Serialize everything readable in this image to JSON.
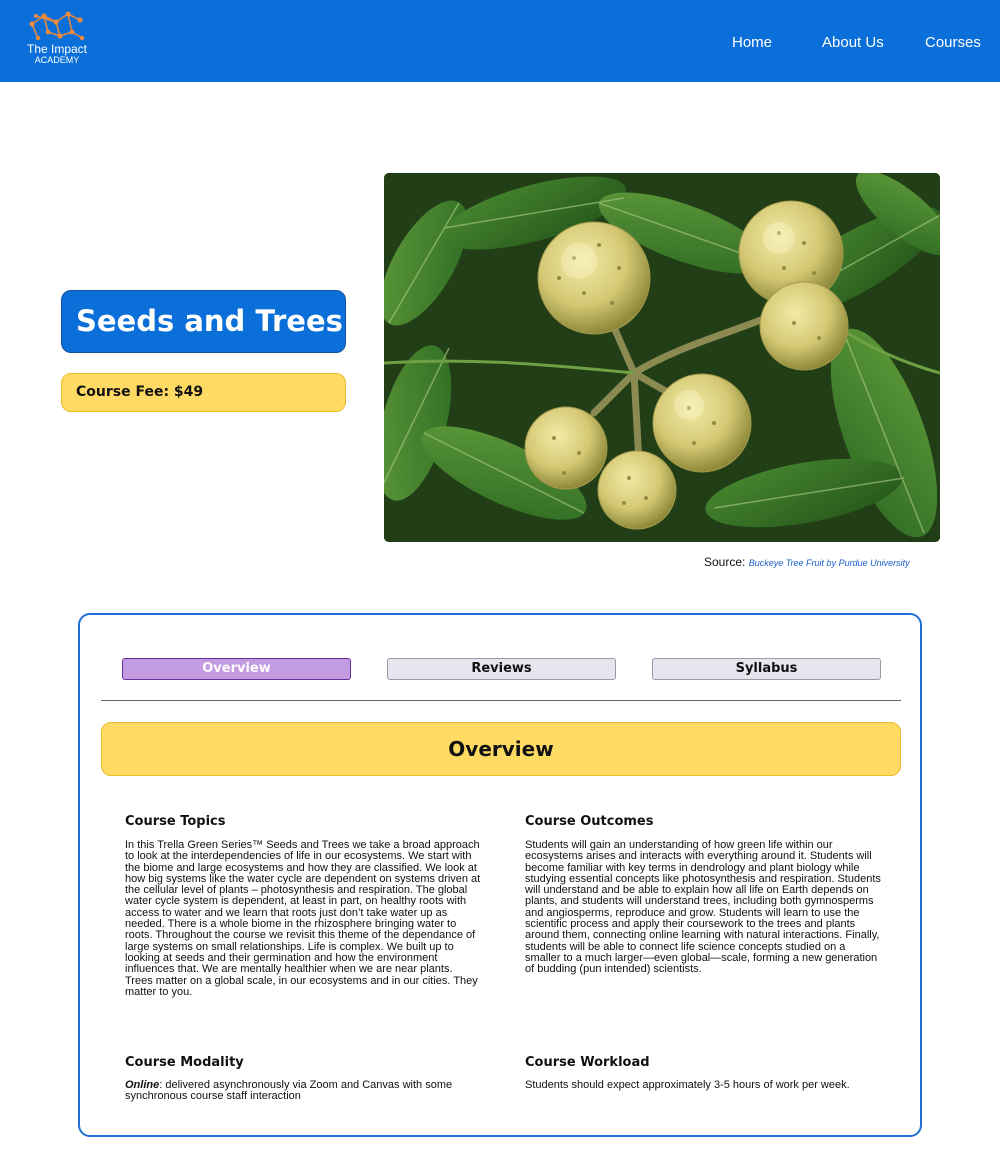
{
  "header": {
    "logo_title": "The Impact",
    "logo_subtitle": "ACADEMY",
    "nav": [
      "Home",
      "About Us",
      "Courses"
    ],
    "background_color": "#0a6fd8"
  },
  "hero": {
    "course_title": "Seeds and Trees",
    "course_fee": "Course Fee: $49",
    "source_label": "Source:",
    "source_link": "Buckeye Tree Fruit by Purdue University"
  },
  "tabs": {
    "items": [
      "Overview",
      "Reviews",
      "Syllabus"
    ],
    "active": "Overview"
  },
  "overview": {
    "heading": "Overview",
    "topics_title": "Course Topics",
    "topics_text": "In this Trella Green Series™ Seeds and Trees we take a broad approach to look at the interdependencies of life in our ecosystems. We start with the biome and large ecosystems and how they are classified. We look at how big systems like the water cycle are dependent on systems driven at the cellular level of plants – photosynthesis and respiration. The global water cycle system is dependent, at least in part, on healthy roots with access to water and we learn that roots just don’t take water up as needed. There is a whole biome in the rhizosphere bringing water to roots. Throughout the course we revisit this theme of the dependance of large systems on small relationships. Life is complex. We built up to looking at seeds and their germination and how the environment influences that. We are mentally healthier when we are near plants. Trees matter on a global scale, in our ecosystems and in our cities. They matter to you.",
    "outcomes_title": "Course Outcomes",
    "outcomes_text": "Students will gain an understanding of how green life within our ecosystems arises and interacts with everything around it. Students will become familiar with key terms in dendrology and plant biology while studying essential concepts like photosynthesis and respiration. Students will understand and be able to explain how all life on Earth depends on plants, and students will understand trees, including both gymnosperms and angiosperms, reproduce and grow. Students will learn to use the scientific process and apply their coursework to the trees and plants around them, connecting online learning with natural interactions. Finally, students will be able to connect life science concepts studied on a smaller to a much larger—even global—scale, forming a new generation of budding (pun intended) scientists.",
    "modality_title": "Course Modality",
    "modality_label": "Online",
    "modality_text": ": delivered asynchronously via Zoom and Canvas with some synchronous course staff interaction",
    "workload_title": "Course Workload",
    "workload_text": "Students should expect approximately 3-5 hours of work per week."
  },
  "colors": {
    "primary_blue": "#0a6fd8",
    "highlight_yellow": "#ffdb64",
    "active_tab_purple": "#c39be0",
    "inactive_tab_gray": "#e6e6ee"
  },
  "icons": {
    "logo": "molecule-network-logo"
  }
}
